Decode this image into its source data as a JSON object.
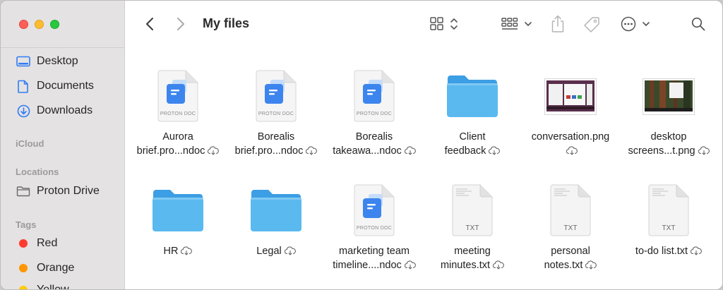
{
  "window": {
    "title": "My files"
  },
  "sidebar": {
    "favorites": [
      {
        "label": "Desktop",
        "icon": "desktop-icon"
      },
      {
        "label": "Documents",
        "icon": "document-icon"
      },
      {
        "label": "Downloads",
        "icon": "download-icon"
      }
    ],
    "icloud_heading": "iCloud",
    "locations_heading": "Locations",
    "locations": [
      {
        "label": "Proton Drive",
        "icon": "folder-outline-icon"
      }
    ],
    "tags_heading": "Tags",
    "tags": [
      {
        "label": "Red",
        "color": "#ff3b30"
      },
      {
        "label": "Orange",
        "color": "#ff9500"
      },
      {
        "label": "Yellow",
        "color": "#ffcc00"
      }
    ]
  },
  "toolbar": {
    "back_icon": "chevron-left-icon",
    "forward_icon": "chevron-right-icon",
    "view_icon": "grid-view-icon",
    "group_icon": "group-icon",
    "share_icon": "share-icon",
    "tag_icon": "tag-icon",
    "more_icon": "ellipsis-circle-icon",
    "search_icon": "search-icon"
  },
  "files": [
    {
      "line1": "Aurora",
      "line2": "brief.pro...ndoc",
      "kind": "proton-doc",
      "badge": "PROTON DOC"
    },
    {
      "line1": "Borealis",
      "line2": "brief.pro...ndoc",
      "kind": "proton-doc",
      "badge": "PROTON DOC"
    },
    {
      "line1": "Borealis",
      "line2": "takeawa...ndoc",
      "kind": "proton-doc",
      "badge": "PROTON DOC"
    },
    {
      "line1": "Client",
      "line2": "feedback",
      "kind": "folder"
    },
    {
      "line1": "conversation.png",
      "line2": "",
      "kind": "image"
    },
    {
      "line1": "desktop",
      "line2": "screens...t.png",
      "kind": "image"
    },
    {
      "line1": "HR",
      "line2": "",
      "kind": "folder"
    },
    {
      "line1": "Legal",
      "line2": "",
      "kind": "folder"
    },
    {
      "line1": "marketing team",
      "line2": "timeline....ndoc",
      "kind": "proton-doc",
      "badge": "PROTON DOC"
    },
    {
      "line1": "meeting",
      "line2": "minutes.txt",
      "kind": "txt",
      "badge": "TXT"
    },
    {
      "line1": "personal",
      "line2": "notes.txt",
      "kind": "txt",
      "badge": "TXT"
    },
    {
      "line1": "to-do list.txt",
      "line2": "",
      "kind": "txt",
      "badge": "TXT"
    }
  ],
  "colors": {
    "accent": "#2f7cf6",
    "folder": "#5ab9ef",
    "sidebar_bg": "#e4e2e2"
  }
}
